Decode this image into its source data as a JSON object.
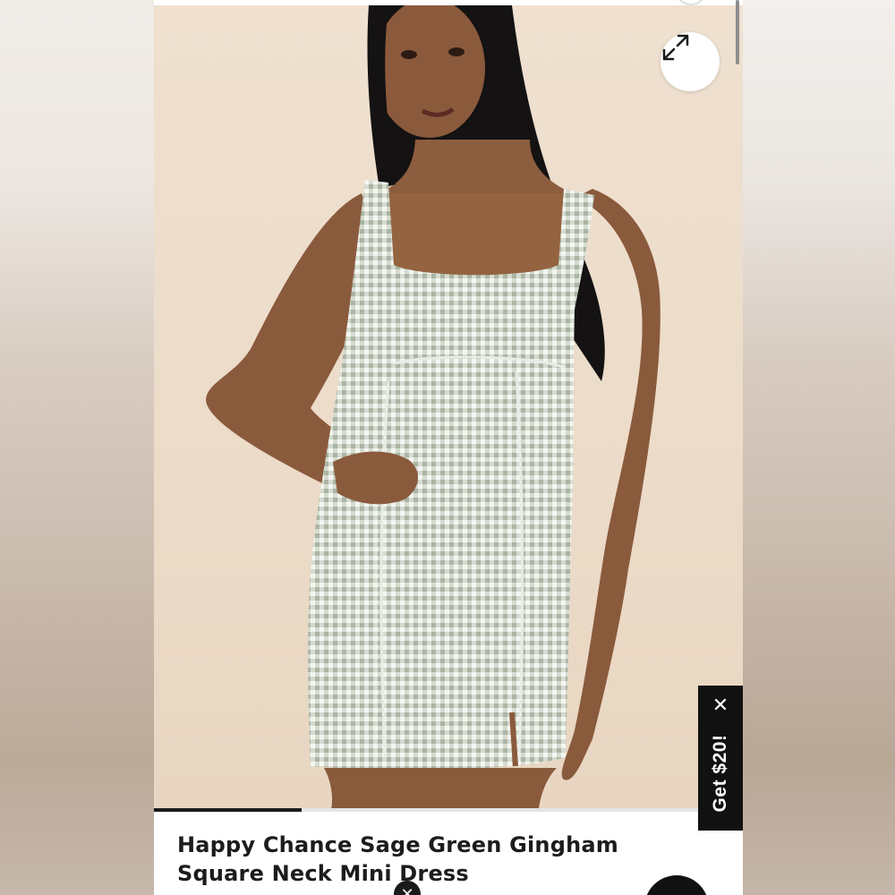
{
  "product": {
    "title": "Happy Chance Sage Green Gingham Square Neck Mini Dress",
    "image_alt": "Model wearing sage green gingham square neck mini dress"
  },
  "gallery": {
    "progress_fraction": 0.25,
    "expand_icon": "expand-arrows-icon"
  },
  "promo": {
    "label": "Get $20!",
    "close_glyph": "✕"
  },
  "overlay": {
    "dismiss_glyph": "✕"
  },
  "colors": {
    "accent": "#111111",
    "background": "#ffffff",
    "text": "#1c1c1c"
  }
}
